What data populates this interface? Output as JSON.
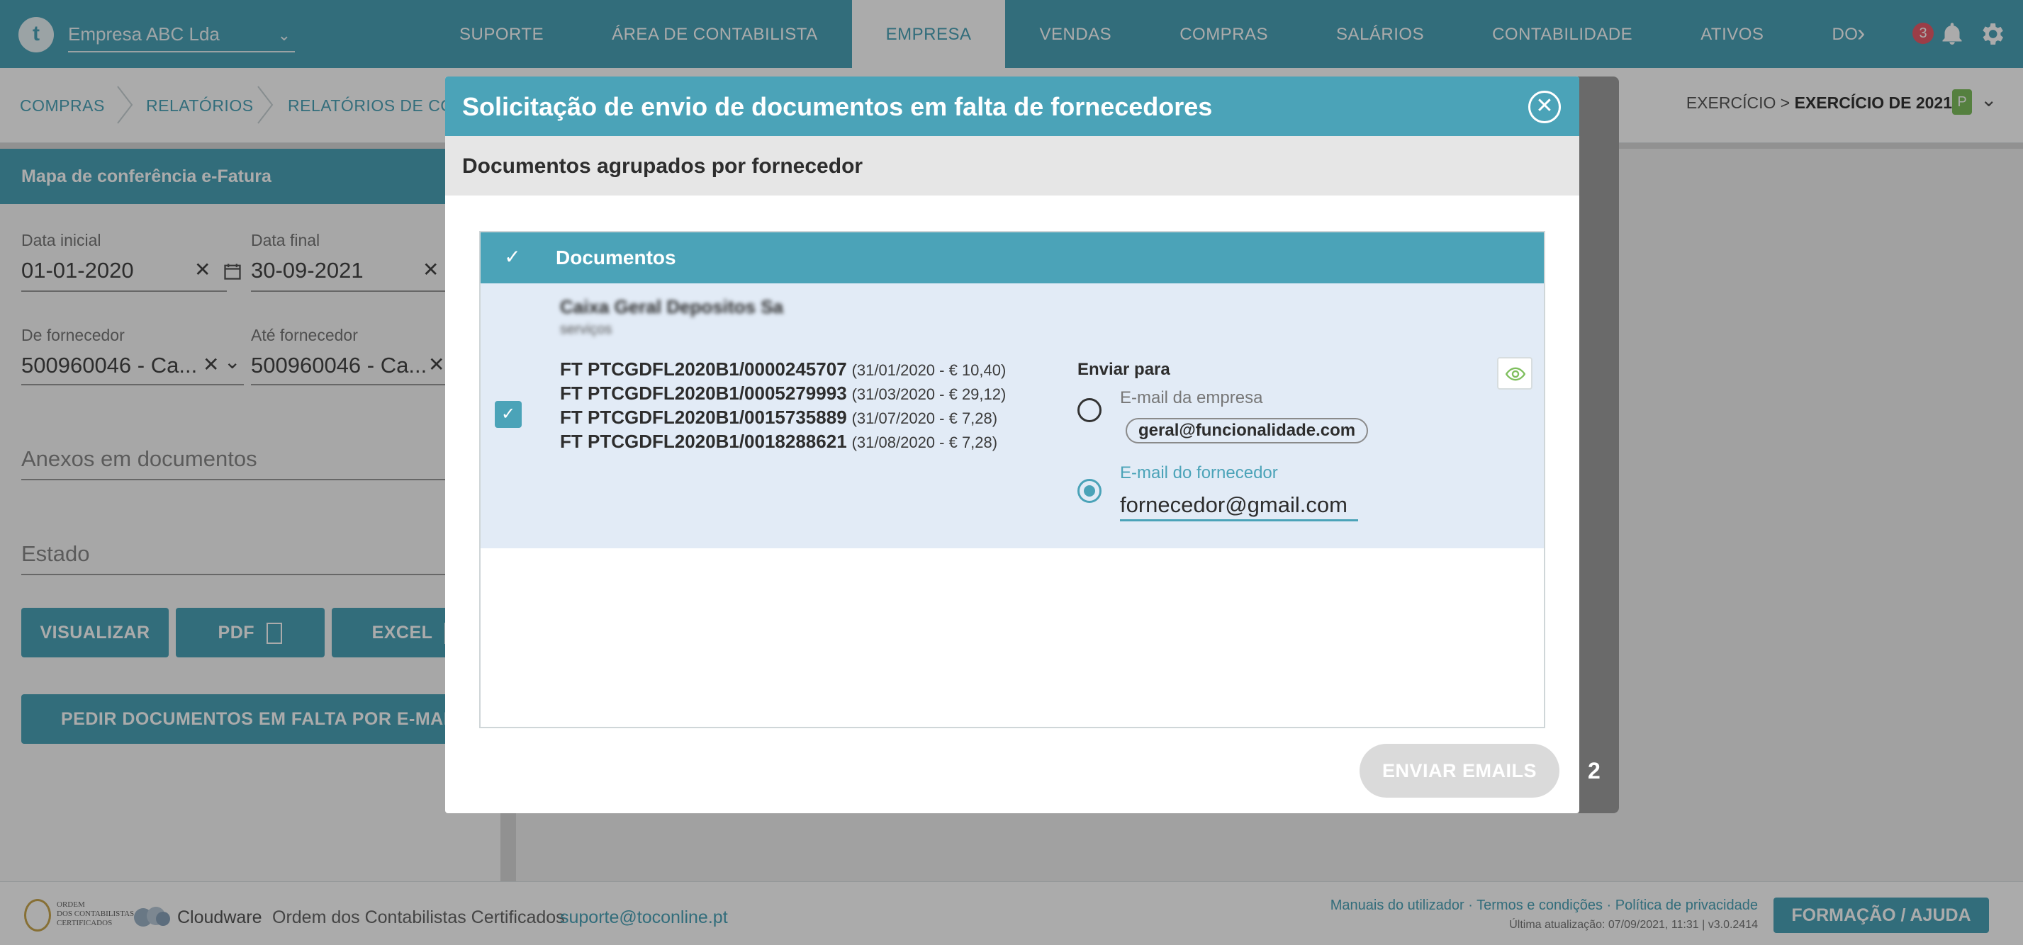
{
  "topbar": {
    "logo": "t",
    "company": "Empresa ABC Lda",
    "nav": [
      "SUPORTE",
      "ÁREA DE CONTABILISTA",
      "EMPRESA",
      "VENDAS",
      "COMPRAS",
      "SALÁRIOS",
      "CONTABILIDADE",
      "ATIVOS",
      "DO"
    ],
    "active_nav": "EMPRESA",
    "notifications": "3"
  },
  "breadcrumb": [
    "COMPRAS",
    "RELATÓRIOS",
    "RELATÓRIOS DE COMPR"
  ],
  "exercise": {
    "prefix": "EXERCÍCIO >",
    "value": "EXERCÍCIO DE 2021",
    "badge": "P"
  },
  "form": {
    "title": "Mapa de conferência e-Fatura",
    "start_label": "Data inicial",
    "start_value": "01-01-2020",
    "end_label": "Data final",
    "end_value": "30-09-2021",
    "from_label": "De fornecedor",
    "from_value": "500960046 - Ca...",
    "to_label": "Até fornecedor",
    "to_value": "500960046 - Ca...",
    "attachments_placeholder": "Anexos em documentos",
    "status_placeholder": "Estado",
    "btn_view": "VISUALIZAR",
    "btn_pdf": "PDF",
    "btn_excel": "EXCEL",
    "btn_request": "PEDIR DOCUMENTOS EM FALTA POR E-MAIL"
  },
  "modal": {
    "title": "Solicitação de envio de documentos em falta de fornecedores",
    "subtitle": "Documentos agrupados por fornecedor",
    "table_header": "Documentos",
    "supplier_name": "Caixa Geral Depositos Sa",
    "supplier_sub": "serviços",
    "documents": [
      {
        "code": "FT PTCGDFL2020B1/0000245707",
        "meta": "(31/01/2020 - € 10,40)"
      },
      {
        "code": "FT PTCGDFL2020B1/0005279993",
        "meta": "(31/03/2020 - € 29,12)"
      },
      {
        "code": "FT PTCGDFL2020B1/0015735889",
        "meta": "(31/07/2020 - € 7,28)"
      },
      {
        "code": "FT PTCGDFL2020B1/0018288621",
        "meta": "(31/08/2020 - € 7,28)"
      }
    ],
    "send_to_label": "Enviar para",
    "option_company": "E-mail da empresa",
    "company_email": "geral@funcionalidade.com",
    "option_supplier": "E-mail do fornecedor",
    "supplier_email": "fornecedor@gmail.com",
    "selected_option": "supplier",
    "send_button": "ENVIAR EMAILS",
    "behind_count": "2"
  },
  "footer": {
    "ordem_logo_text": [
      "ORDEM",
      "DOS CONTABILISTAS",
      "CERTIFICADOS"
    ],
    "cloudware": "Cloudware",
    "org": "Ordem dos Contabilistas Certificados",
    "support_email": "suporte@toconline.pt",
    "links": "Manuais do utilizador · Termos e condições · Política de privacidade",
    "updated": "Última atualização: 07/09/2021, 11:31 | v3.0.2414",
    "help_button": "FORMAÇÃO / AJUDA"
  },
  "colors": {
    "accent": "#4ba3b8",
    "row_bg": "#e2ebf6",
    "disabled_button": "#dadada",
    "badge_red": "#e85b6b",
    "badge_green": "#7fbf5e"
  }
}
